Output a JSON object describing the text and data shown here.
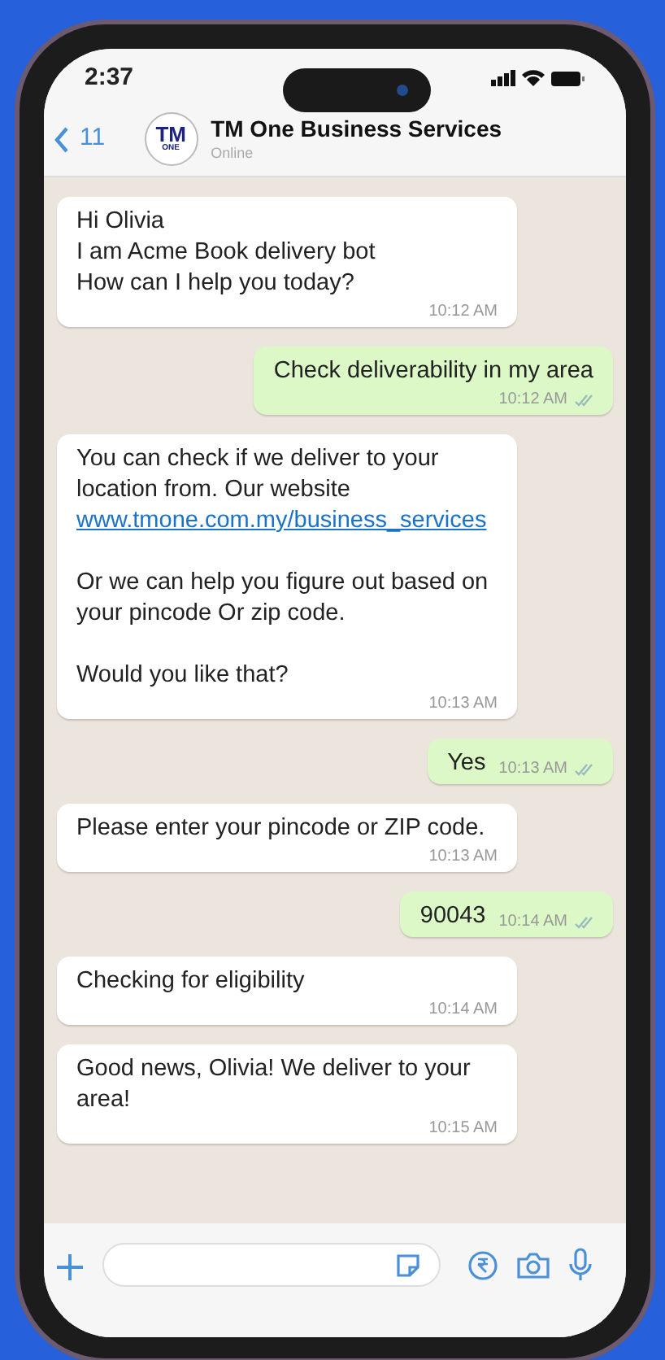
{
  "status_bar": {
    "time": "2:37"
  },
  "header": {
    "back_count": "11",
    "avatar": {
      "line1": "TM",
      "line2": "ONE"
    },
    "name": "TM One Business Services",
    "status": "Online"
  },
  "messages": [
    {
      "kind": "received",
      "blocks": [
        {
          "kind": "line",
          "text": "Hi Olivia"
        },
        {
          "kind": "line",
          "text": "I am Acme Book delivery bot"
        },
        {
          "kind": "line",
          "text": "How can I help you today?"
        }
      ],
      "time": "10:12 AM"
    },
    {
      "kind": "sent",
      "blocks": [
        {
          "kind": "line",
          "text": "Check deliverability in my area"
        }
      ],
      "time": "10:12 AM"
    },
    {
      "kind": "received",
      "blocks": [
        {
          "kind": "line",
          "text": "You can check if we deliver to your location from. Our website"
        },
        {
          "kind": "link",
          "text": "www.tmone.com.my/business_services"
        },
        {
          "kind": "paragraph",
          "text": "Or we can help you figure out based on your pincode Or zip code."
        },
        {
          "kind": "paragraph",
          "text": "Would you like that?"
        }
      ],
      "time": "10:13 AM"
    },
    {
      "kind": "sent",
      "blocks": [
        {
          "kind": "line",
          "text": "Yes"
        }
      ],
      "time": "10:13 AM"
    },
    {
      "kind": "received",
      "blocks": [
        {
          "kind": "line",
          "text": "Please enter your pincode or ZIP code."
        }
      ],
      "time": "10:13 AM"
    },
    {
      "kind": "sent",
      "blocks": [
        {
          "kind": "line",
          "text": "90043"
        }
      ],
      "time": "10:14 AM"
    },
    {
      "kind": "received",
      "blocks": [
        {
          "kind": "line",
          "text": "Checking for eligibility"
        }
      ],
      "time": "10:14 AM"
    },
    {
      "kind": "received",
      "blocks": [
        {
          "kind": "line",
          "text": "Good news, Olivia! We deliver to your area!"
        }
      ],
      "time": "10:15 AM"
    }
  ]
}
